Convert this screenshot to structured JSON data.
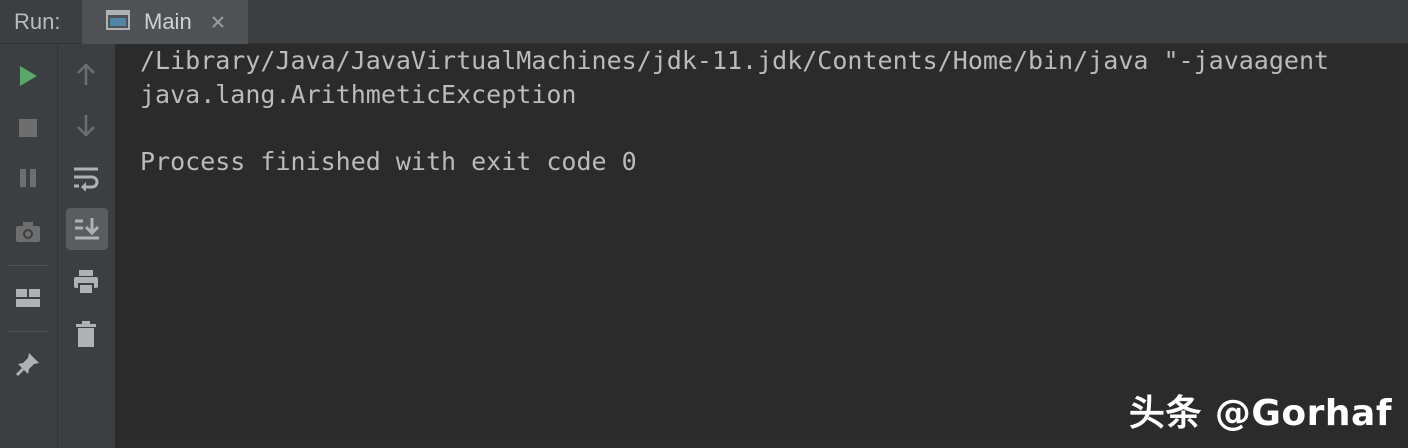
{
  "header": {
    "run_label": "Run:",
    "tab_label": "Main"
  },
  "toolbar_left": [
    {
      "name": "rerun-icon",
      "color": "#59a869"
    },
    {
      "name": "stop-icon",
      "color": "#6e6e6e"
    },
    {
      "name": "pause-icon",
      "color": "#6e6e6e"
    },
    {
      "name": "camera-icon",
      "color": "#6e6e6e"
    },
    {
      "name": "layout-icon",
      "color": "#afb1b3"
    },
    {
      "name": "pin-icon",
      "color": "#afb1b3"
    }
  ],
  "toolbar_right": [
    {
      "name": "up-arrow-icon",
      "color": "#6e6e6e"
    },
    {
      "name": "down-arrow-icon",
      "color": "#6e6e6e"
    },
    {
      "name": "soft-wrap-icon",
      "color": "#afb1b3"
    },
    {
      "name": "scroll-to-end-icon",
      "color": "#afb1b3"
    },
    {
      "name": "print-icon",
      "color": "#afb1b3"
    },
    {
      "name": "trash-icon",
      "color": "#afb1b3"
    }
  ],
  "console": {
    "lines": [
      "/Library/Java/JavaVirtualMachines/jdk-11.jdk/Contents/Home/bin/java \"-javaagent",
      "java.lang.ArithmeticException",
      "",
      "Process finished with exit code 0"
    ]
  },
  "watermark": "头条 @Gorhaf"
}
